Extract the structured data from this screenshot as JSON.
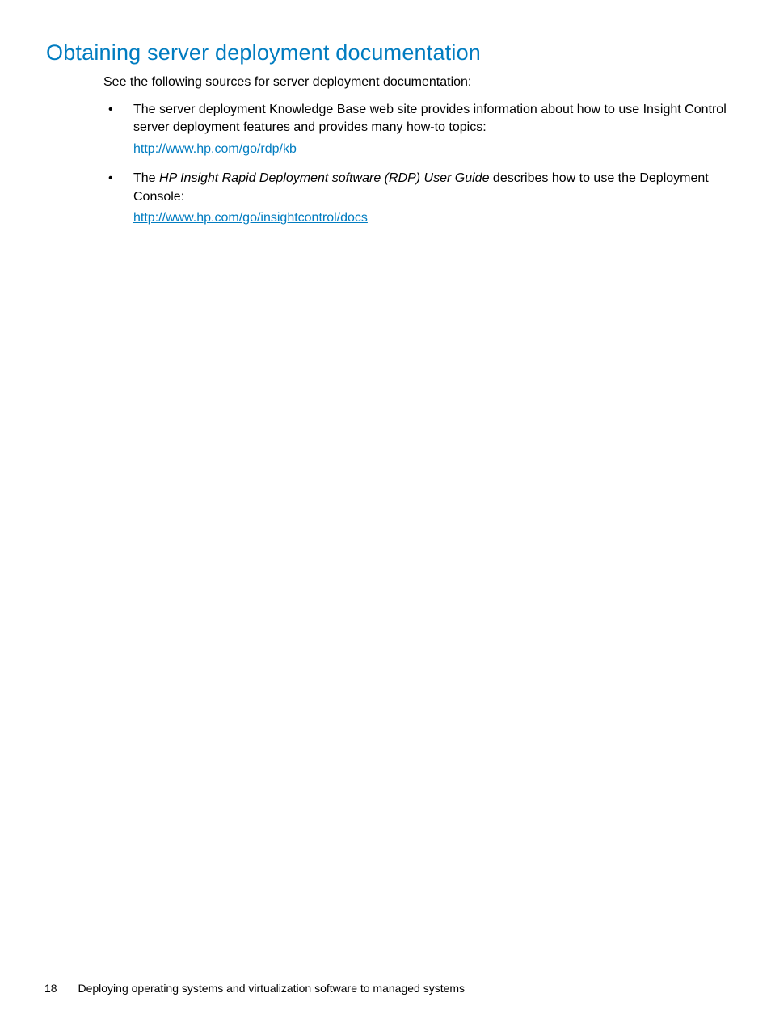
{
  "heading": "Obtaining server deployment documentation",
  "intro": "See the following sources for server deployment documentation:",
  "bullets": [
    {
      "text_before": "The server deployment Knowledge Base web site provides information about how to use Insight Control server deployment features and provides many how-to topics:",
      "italic_text": "",
      "text_after": "",
      "link": "http://www.hp.com/go/rdp/kb"
    },
    {
      "text_before": "The ",
      "italic_text": "HP Insight Rapid Deployment software (RDP) User Guide",
      "text_after": " describes how to use the Deployment Console:",
      "link": "http://www.hp.com/go/insightcontrol/docs"
    }
  ],
  "footer": {
    "page_number": "18",
    "text": "Deploying operating systems and virtualization software to managed systems"
  }
}
